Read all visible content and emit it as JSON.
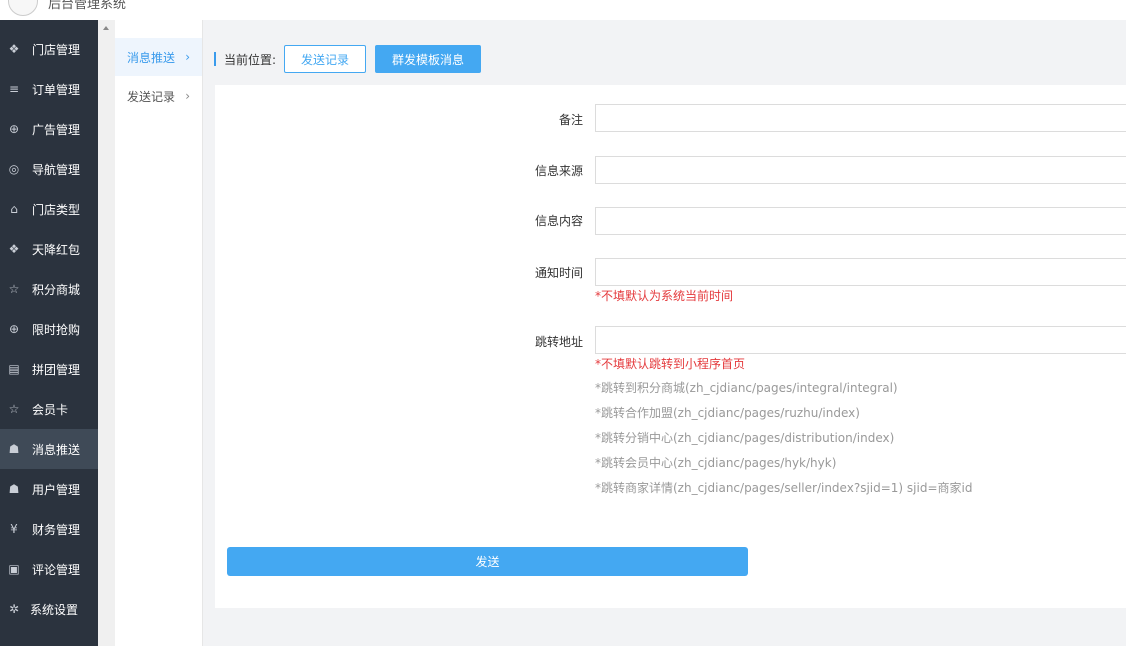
{
  "app": {
    "title": "后台管理系统"
  },
  "sidebar": {
    "items": [
      {
        "label": "门店管理",
        "icon": "cubes-icon",
        "glyph": "❖"
      },
      {
        "label": "订单管理",
        "icon": "list-icon",
        "glyph": "≡"
      },
      {
        "label": "广告管理",
        "icon": "lifebuoy-icon",
        "glyph": "⊕"
      },
      {
        "label": "导航管理",
        "icon": "compass-icon",
        "glyph": "◎"
      },
      {
        "label": "门店类型",
        "icon": "bank-icon",
        "glyph": "⌂"
      },
      {
        "label": "天降红包",
        "icon": "cubes-icon",
        "glyph": "❖"
      },
      {
        "label": "积分商城",
        "icon": "star-icon",
        "glyph": "☆"
      },
      {
        "label": "限时抢购",
        "icon": "lifebuoy-icon",
        "glyph": "⊕"
      },
      {
        "label": "拼团管理",
        "icon": "keyboard-icon",
        "glyph": "▤"
      },
      {
        "label": "会员卡",
        "icon": "star-icon",
        "glyph": "☆"
      },
      {
        "label": "消息推送",
        "icon": "users-icon",
        "glyph": "☗"
      },
      {
        "label": "用户管理",
        "icon": "user-icon",
        "glyph": "☗"
      },
      {
        "label": "财务管理",
        "icon": "yen-icon",
        "glyph": "¥"
      },
      {
        "label": "评论管理",
        "icon": "money-icon",
        "glyph": "▣"
      },
      {
        "label": "系统设置",
        "icon": "gear-icon",
        "glyph": "✲"
      }
    ],
    "active_index": 10
  },
  "subnav": {
    "items": [
      {
        "label": "消息推送",
        "chevron": "›"
      },
      {
        "label": "发送记录",
        "chevron": "›"
      }
    ]
  },
  "breadcrumb": {
    "label": "当前位置:",
    "btn_record": "发送记录",
    "btn_template": "群发模板消息"
  },
  "form": {
    "remark_label": "备注",
    "source_label": "信息来源",
    "content_label": "信息内容",
    "time_label": "通知时间",
    "time_hint": "*不填默认为系统当前时间",
    "url_label": "跳转地址",
    "url_hint": "*不填默认跳转到小程序首页",
    "url_examples": [
      "*跳转到积分商城(zh_cjdianc/pages/integral/integral)",
      "*跳转合作加盟(zh_cjdianc/pages/ruzhu/index)",
      "*跳转分销中心(zh_cjdianc/pages/distribution/index)",
      "*跳转会员中心(zh_cjdianc/pages/hyk/hyk)",
      "*跳转商家详情(zh_cjdianc/pages/seller/index?sjid=1) sjid=商家id"
    ],
    "submit": "发送"
  },
  "colors": {
    "accent": "#44a8f2",
    "sidebar_bg": "#2b333e",
    "hint_red": "#e4393c"
  }
}
